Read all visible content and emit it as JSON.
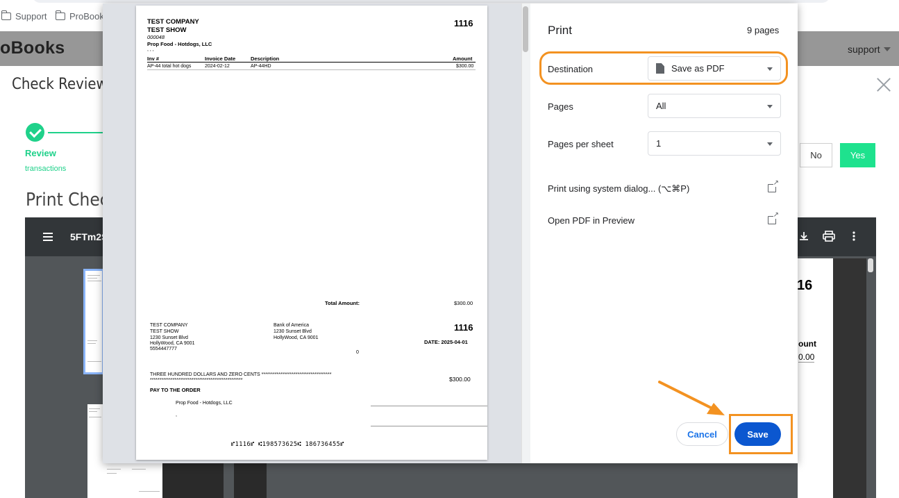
{
  "browser": {
    "bookmarks": [
      {
        "label": "Support",
        "icon": "folder-icon"
      },
      {
        "label": "ProBook",
        "icon": "folder-icon"
      }
    ]
  },
  "app": {
    "brand": "oBooks",
    "user_menu": "support"
  },
  "page": {
    "heading": "Check Review",
    "step_label": "Review",
    "step_sublabel": "transactions",
    "no_label": "No",
    "yes_label": "Yes",
    "print_heading": "Print Chec"
  },
  "viewer": {
    "file_name": "5FTm2S",
    "doc_number": "16",
    "amount_header": "ount",
    "amount_value": "0.00"
  },
  "document": {
    "company": "TEST COMPANY",
    "show": "TEST SHOW",
    "ref": "000048",
    "vendor": "Prop Food - Hotdogs, LLC",
    "blank_line": ", , ,",
    "check_number": "1116",
    "table_headers": [
      "Inv #",
      "Invoice Date",
      "Description",
      "Amount"
    ],
    "table_rows": [
      [
        "AP-44 total hot dogs",
        "2024-02-12",
        "AP-44HD",
        "$300.00"
      ]
    ],
    "total_label": "Total Amount:",
    "total_value": "$300.00",
    "payer_lines": [
      "TEST COMPANY",
      "TEST SHOW",
      "1230 Sunset Blvd",
      "HollyWood, CA  9001",
      "5554447777"
    ],
    "bank_lines": [
      "Bank of America",
      "1230 Sunset Blvd",
      "HollyWood, CA  9001"
    ],
    "check_number_2": "1116",
    "date_label": "DATE:  2025-04-01",
    "zero": "0",
    "amount_words": "THREE HUNDRED DOLLARS AND ZERO CENTS *************************************",
    "amount_stars": "*************************************************",
    "check_amount": "$300.00",
    "pay_to": "PAY TO THE ORDER",
    "payee": "Prop Food - Hotdogs, LLC",
    "payee_line2": ",",
    "micr": "⑈1116⑈  ⑆198573625⑆   186736455⑈"
  },
  "print_dialog": {
    "title": "Print",
    "page_count": "9 pages",
    "destination_label": "Destination",
    "destination_value": "Save as PDF",
    "pages_label": "Pages",
    "pages_value": "All",
    "pps_label": "Pages per sheet",
    "pps_value": "1",
    "system_dialog": "Print using system dialog... (⌥⌘P)",
    "open_pdf": "Open PDF in Preview",
    "cancel": "Cancel",
    "save": "Save"
  },
  "colors": {
    "annotation": "#f39221",
    "primary": "#0b57d0",
    "success": "#1fd18a"
  }
}
